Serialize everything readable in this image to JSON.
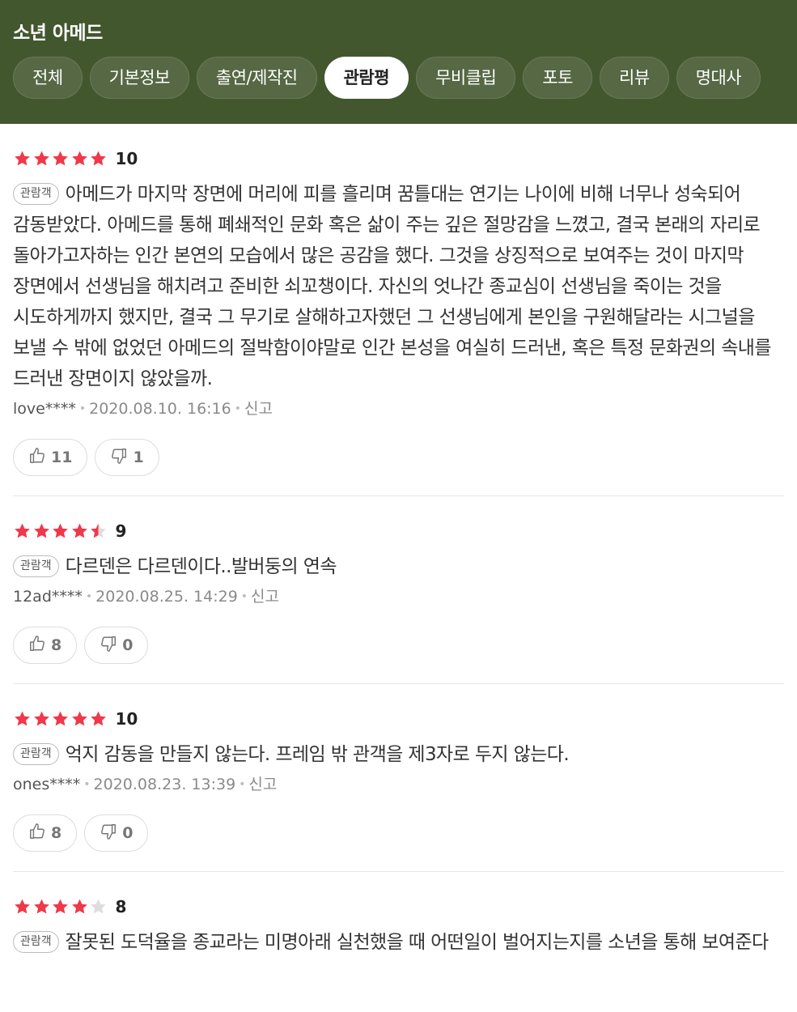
{
  "header": {
    "title": "소년 아메드",
    "tabs": [
      {
        "label": "전체",
        "active": false
      },
      {
        "label": "기본정보",
        "active": false
      },
      {
        "label": "출연/제작진",
        "active": false
      },
      {
        "label": "관람평",
        "active": true
      },
      {
        "label": "무비클립",
        "active": false
      },
      {
        "label": "포토",
        "active": false
      },
      {
        "label": "리뷰",
        "active": false
      },
      {
        "label": "명대사",
        "active": false
      }
    ]
  },
  "colors": {
    "header_bg": "#43572f",
    "star_on": "#f0384a",
    "star_off": "#dddddd"
  },
  "reviews": [
    {
      "stars": 5,
      "score": "10",
      "badge": "관람객",
      "text": "아메드가 마지막 장면에 머리에 피를 흘리며 꿈틀대는 연기는 나이에 비해 너무나 성숙되어 감동받았다. 아메드를 통해 폐쇄적인 문화 혹은 삶이 주는 깊은 절망감을 느꼈고, 결국 본래의 자리로 돌아가고자하는 인간 본연의 모습에서 많은 공감을 했다. 그것을 상징적으로 보여주는 것이 마지막 장면에서 선생님을 해치려고 준비한 쇠꼬챙이다. 자신의 엇나간 종교심이 선생님을 죽이는 것을 시도하게까지 했지만, 결국 그 무기로 살해하고자했던 그 선생님에게 본인을 구원해달라는 시그널을 보낼 수 밖에 없었던 아메드의 절박함이야말로 인간 본성을 여실히 드러낸, 혹은 특정 문화권의 속내를 드러낸 장면이지 않았을까.",
      "user": "love****",
      "date": "2020.08.10. 16:16",
      "report": "신고",
      "likes": "11",
      "dislikes": "1"
    },
    {
      "stars": 4.5,
      "score": "9",
      "badge": "관람객",
      "text": "다르덴은 다르덴이다..발버둥의 연속",
      "user": "12ad****",
      "date": "2020.08.25. 14:29",
      "report": "신고",
      "likes": "8",
      "dislikes": "0"
    },
    {
      "stars": 5,
      "score": "10",
      "badge": "관람객",
      "text": "억지 감동을 만들지 않는다. 프레임 밖 관객을 제3자로 두지 않는다.",
      "user": "ones****",
      "date": "2020.08.23. 13:39",
      "report": "신고",
      "likes": "8",
      "dislikes": "0"
    },
    {
      "stars": 4,
      "score": "8",
      "badge": "관람객",
      "text": "잘못된 도덕율을 종교라는 미명아래 실천했을 때 어떤일이 벌어지는지를 소년을 통해 보여준다",
      "user": "",
      "date": "",
      "report": "",
      "likes": "",
      "dislikes": ""
    }
  ]
}
